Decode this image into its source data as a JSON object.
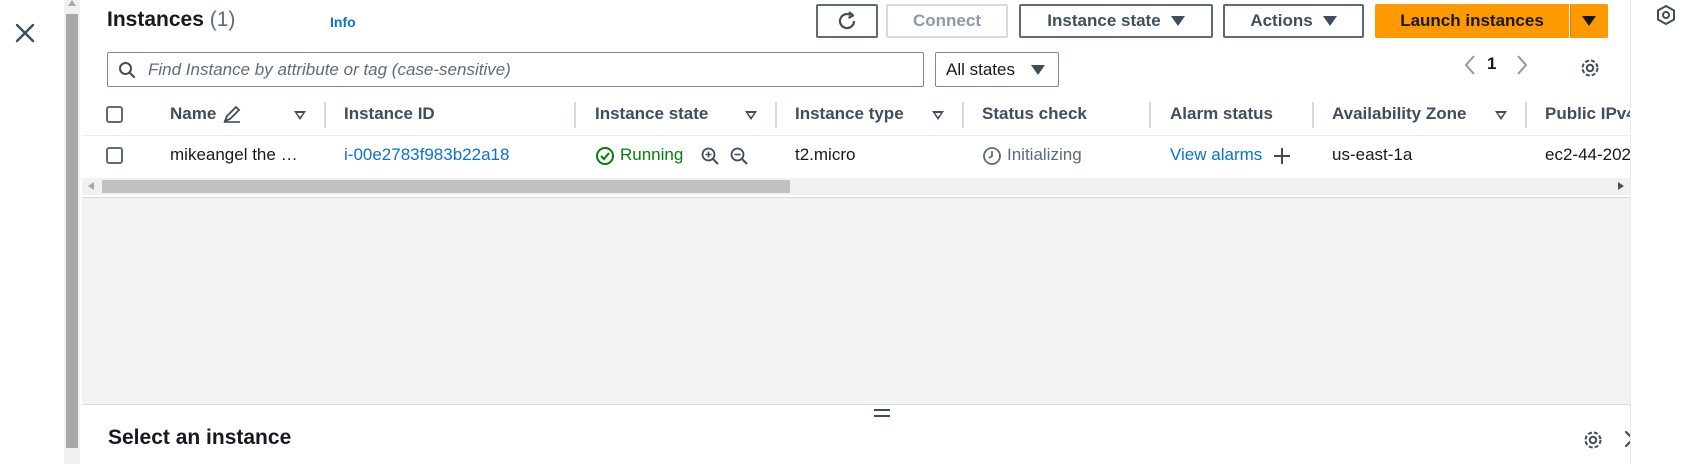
{
  "header": {
    "title": "Instances",
    "count": "(1)",
    "info_label": "Info"
  },
  "toolbar": {
    "connect_label": "Connect",
    "instance_state_label": "Instance state",
    "actions_label": "Actions",
    "launch_label": "Launch instances"
  },
  "search": {
    "placeholder": "Find Instance by attribute or tag (case-sensitive)"
  },
  "filter": {
    "selected": "All states"
  },
  "pagination": {
    "current_page": "1"
  },
  "table": {
    "columns": [
      "Name",
      "Instance ID",
      "Instance state",
      "Instance type",
      "Status check",
      "Alarm status",
      "Availability Zone",
      "Public IPv4"
    ],
    "rows": [
      {
        "name": "mikeangel the …",
        "instance_id": "i-00e2783f983b22a18",
        "state": "Running",
        "type": "t2.micro",
        "status_check": "Initializing",
        "alarm_status": "View alarms",
        "availability_zone": "us-east-1a",
        "public_ipv4": "ec2-44-202"
      }
    ]
  },
  "details_panel": {
    "title": "Select an instance"
  },
  "colors": {
    "primary": "#ff9900",
    "link": "#0972d3",
    "running": "#037f0c",
    "text": "#16191f"
  }
}
